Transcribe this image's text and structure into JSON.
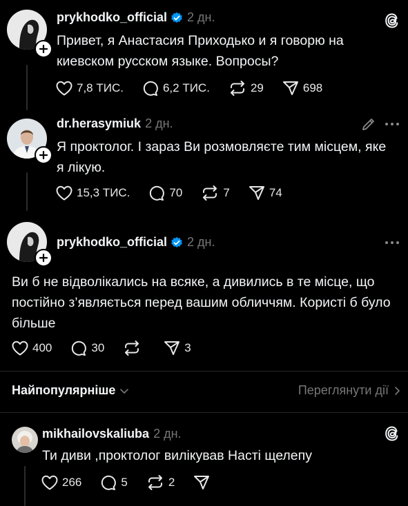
{
  "posts": [
    {
      "username": "prykhodko_official",
      "time": "2 дн.",
      "text": "Привет, я Анастасия Приходько и я говорю на киевском русском языке. Вопросы?",
      "likes": "7,8 ТИС.",
      "replies": "6,2 ТИС.",
      "reposts": "29",
      "shares": "698"
    },
    {
      "username": "dr.herasymiuk",
      "time": "2 дн.",
      "text": "Я проктолог. І зараз Ви розмовляєте тим місцем, яке я лікую.",
      "likes": "15,3 ТИС.",
      "replies": "70",
      "reposts": "7",
      "shares": "74"
    },
    {
      "username": "prykhodko_official",
      "time": "2 дн.",
      "text": "Ви б не відволікались на всяке, а дивились в те місце, що постійно з’являється перед вашим обличчям. Користі б було більше",
      "likes": "400",
      "replies": "30",
      "reposts": "",
      "shares": "3"
    }
  ],
  "sort_bar": {
    "label": "Найпопулярніше",
    "activity_link": "Переглянути дії"
  },
  "reply": {
    "username": "mikhailovskaliuba",
    "time": "2 дн.",
    "text": "Ти диви ,проктолог вилікував Насті щелепу",
    "likes": "266",
    "replies": "5",
    "reposts": "2",
    "shares": ""
  },
  "colors": {
    "background": "#000000",
    "text": "#f3f5f7",
    "muted": "#777777",
    "verified": "#0095f6"
  }
}
